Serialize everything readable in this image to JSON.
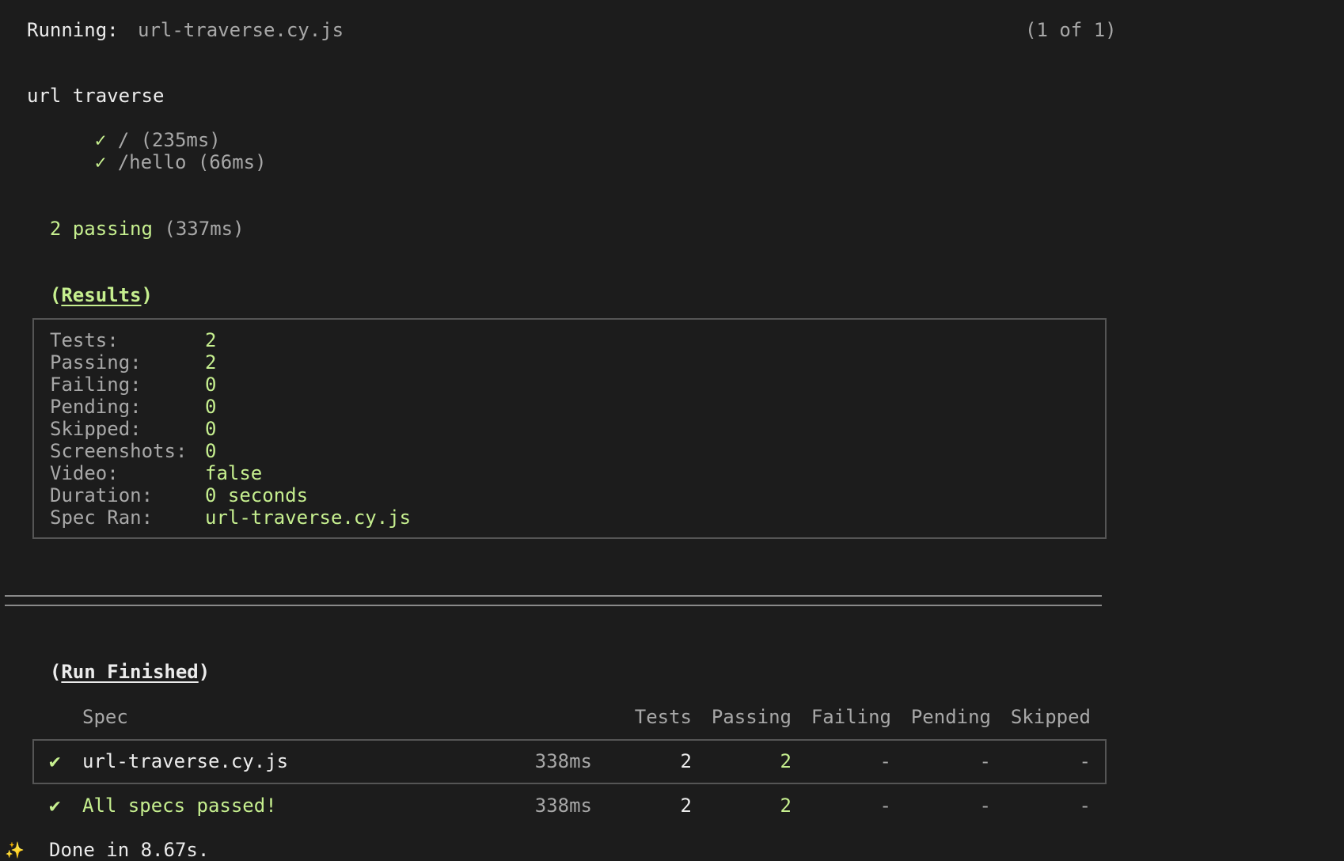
{
  "header": {
    "running_label": "Running:",
    "spec_file": "url-traverse.cy.js",
    "counter": "(1 of 1)"
  },
  "suite": {
    "title": "url traverse",
    "tests": [
      {
        "check": "✓",
        "name": "/",
        "duration": "(235ms)"
      },
      {
        "check": "✓",
        "name": "/hello",
        "duration": "(66ms)"
      }
    ]
  },
  "summary": {
    "passing_text": "2 passing",
    "duration": "(337ms)"
  },
  "results": {
    "open_paren": "(",
    "title": "Results",
    "close_paren": ")",
    "rows": [
      {
        "label": "Tests:",
        "value": "2"
      },
      {
        "label": "Passing:",
        "value": "2"
      },
      {
        "label": "Failing:",
        "value": "0"
      },
      {
        "label": "Pending:",
        "value": "0"
      },
      {
        "label": "Skipped:",
        "value": "0"
      },
      {
        "label": "Screenshots:",
        "value": "0"
      },
      {
        "label": "Video:",
        "value": "false"
      },
      {
        "label": "Duration:",
        "value": "0 seconds"
      },
      {
        "label": "Spec Ran:",
        "value": "url-traverse.cy.js"
      }
    ]
  },
  "run_finished": {
    "open_paren": "(",
    "title": "Run Finished",
    "close_paren": ")"
  },
  "table": {
    "headers": {
      "spec": "Spec",
      "tests": "Tests",
      "passing": "Passing",
      "failing": "Failing",
      "pending": "Pending",
      "skipped": "Skipped"
    },
    "row": {
      "check": "✔",
      "spec": "url-traverse.cy.js",
      "time": "338ms",
      "tests": "2",
      "passing": "2",
      "failing": "-",
      "pending": "-",
      "skipped": "-"
    },
    "total": {
      "check": "✔",
      "spec": "All specs passed!",
      "time": "338ms",
      "tests": "2",
      "passing": "2",
      "failing": "-",
      "pending": "-",
      "skipped": "-"
    }
  },
  "footer": {
    "sparkle": "✨",
    "done_text": "Done in 8.67s."
  },
  "colors": {
    "background": "#1c1c1c",
    "green": "#c6ef8f",
    "gray": "#a8a8a8",
    "border": "#555555"
  }
}
